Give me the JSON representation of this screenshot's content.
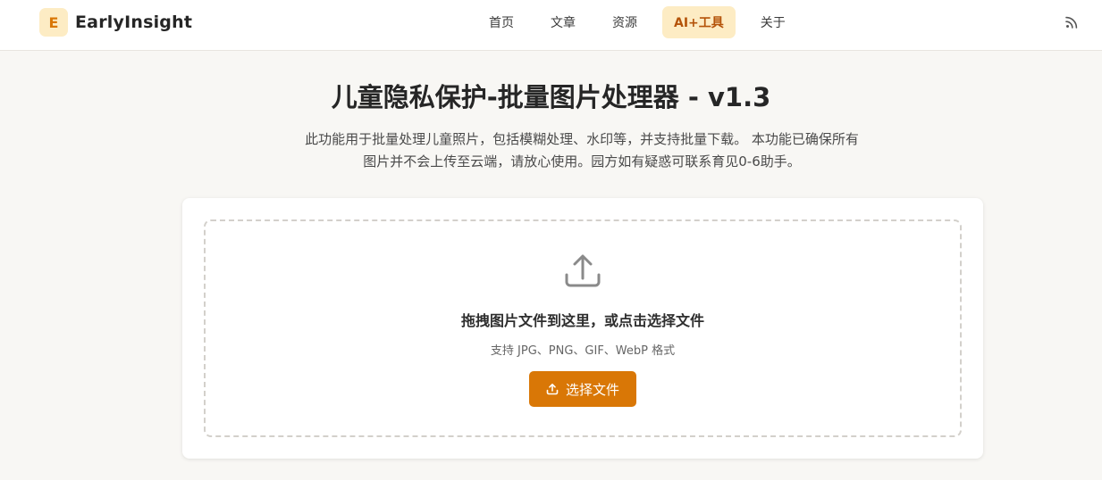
{
  "brand": {
    "badge": "E",
    "name": "EarlyInsight"
  },
  "nav": {
    "items": [
      {
        "label": "首页",
        "active": false
      },
      {
        "label": "文章",
        "active": false
      },
      {
        "label": "资源",
        "active": false
      },
      {
        "label": "AI+工具",
        "active": true
      },
      {
        "label": "关于",
        "active": false
      }
    ],
    "rss_icon": "rss-icon"
  },
  "hero": {
    "title": "儿童隐私保护-批量图片处理器 - v1.3",
    "desc_line1": "此功能用于批量处理儿童照片，包括模糊处理、水印等，并支持批量下载。 本功能已确保所有",
    "desc_line2": "图片并不会上传至云端，请放心使用。园方如有疑惑可联系育见0-6助手。"
  },
  "upload": {
    "icon": "upload-icon",
    "title": "拖拽图片文件到这里，或点击选择文件",
    "hint": "支持 JPG、PNG、GIF、WebP 格式",
    "button_label": "选择文件"
  },
  "colors": {
    "accent": "#d97706",
    "accent_soft": "#fdecc4",
    "background": "#f8f7f4"
  }
}
